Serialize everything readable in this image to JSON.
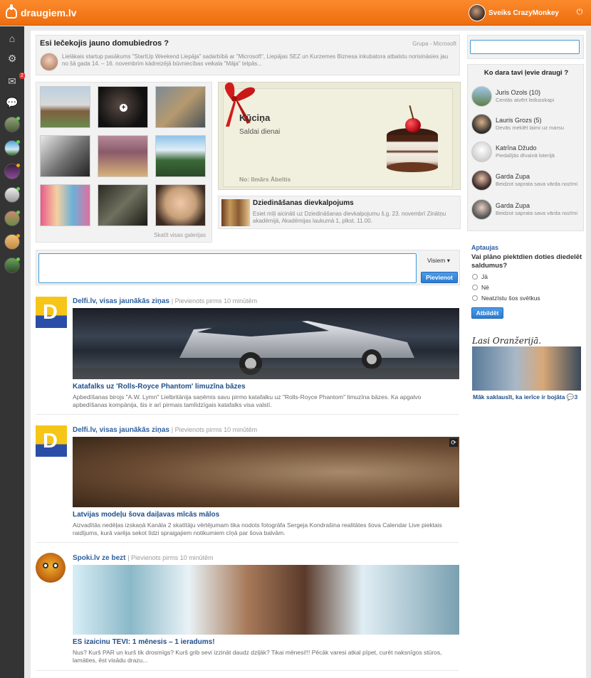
{
  "app": {
    "name": "draugiem.lv",
    "greeting": "Sveiks CrazyMonkey"
  },
  "colors": {
    "brand": "#f07a1a",
    "link": "#2c5f9e",
    "accent_blue": "#2c7bd0"
  },
  "rail": {
    "mail_badge": "2"
  },
  "group_card": {
    "title": "Esi Iečekojis jauno domubiedros ?",
    "meta": "Grupa - Microsoft",
    "text": "Lielākais startup pasākums \"StartUp Weekend Liepāja\" sadarbībā ar \"Microsoft\", Liepājas SEZ un Kurzemes Biznesa inkubatora atbalstu norisināsies jau no šā gada 14. – 16. novembrim kādreizējā būvniecības veikala \"Māja\" telpās..."
  },
  "gallery": {
    "more_link": "Skatīt visas galerijas"
  },
  "gift": {
    "title": "Kūciņa",
    "subtitle": "Saldai dienai",
    "from": "No: Ilmārs Ābeltis"
  },
  "event": {
    "title": "Dziedināšanas dievkalpojums",
    "text": "Esiet mīļi aicināti uz Dziedināšanas dievkalpojumu š.g. 23. novembrī Zinātņu akadēmijā, Akadēmijas laukumā 1, plkst. 11.00."
  },
  "composer": {
    "audience": "Visiem",
    "submit": "Pievienot"
  },
  "posts": [
    {
      "source": "Delfi.lv, visas jaunākās ziņas",
      "time": "| Pievienots pirms 10 minūtēm",
      "title": "Katafalks uz 'Rolls-Royce Phantom' limuzīna bāzes",
      "desc": "Apbedīšanas birojs \"A.W. Lymn\" Lielbritānija saņēmis savu pirmo katafalku uz \"Rolls-Royce Phantom\" limuzīna bāzes. Ka apgalvo apbedīšanas kompānija, šis ir arī pirmais tamlīdzīgais katafalks visa valstī."
    },
    {
      "source": "Delfi.lv, visas jaunākās ziņas",
      "time": "| Pievienots pirms 10 minūtēm",
      "title": "Latvijas modeļu šova daiļavas mīcās mālos",
      "desc": "Aizvadītās nedēļas izskaņā Kanāla 2 skatītāju vērtējumam tika nodots fotogrāfa Sergeja Kondrašina realitātes šova Calendar Live piektais raidījums, kurā varēja sekot līdzi spraigajiem notikumiem cīņā par šova balvām."
    },
    {
      "source": "Spoki.lv ze bezt",
      "time": "| Pievienots pirms 10 minūtēm",
      "title": "ES izaicinu TEVI: 1 mēnesis – 1 ieradums!",
      "desc": "Nus? Kurš PAR un kurš tik drosmīgs? Kurš grib sevi izzināt daudz dziļāk? Tikai mēnesi!!! Pēcāk varesi atkal pīpet, curēt naksnīgos stūros, lamāties, ēst visādu drazu..."
    }
  ],
  "sidebar": {
    "friends_title": "Ko dara tavi ļevie draugi ?",
    "friends": [
      {
        "name": "Juris Ozols (10)",
        "status": "Centās atvērt ledusskapi"
      },
      {
        "name": "Lauris Grozs (5)",
        "status": "Devās meklēt laimi uz marsu"
      },
      {
        "name": "Katrīna Džudo",
        "status": "Piedalījās dīvainā loterijā"
      },
      {
        "name": "Garda Zupa",
        "status": "Beidzot saprata sava vārda nozīmi"
      },
      {
        "name": "Garda Zupa",
        "status": "Beidzot saprata sava vārda nozīmi"
      }
    ],
    "poll": {
      "heading": "Aptaujas",
      "question": "Vai plāno piektdien doties diedelēt saldumus?",
      "options": [
        "Jā",
        "Nē",
        "Neatzīstu šos svētkus"
      ],
      "submit": "Atbildēt"
    },
    "promo": {
      "logo": "Lasi Oranžerijā.",
      "caption": "Māk saklausīt, ka ierīce ir bojāta",
      "comments": "3"
    }
  }
}
